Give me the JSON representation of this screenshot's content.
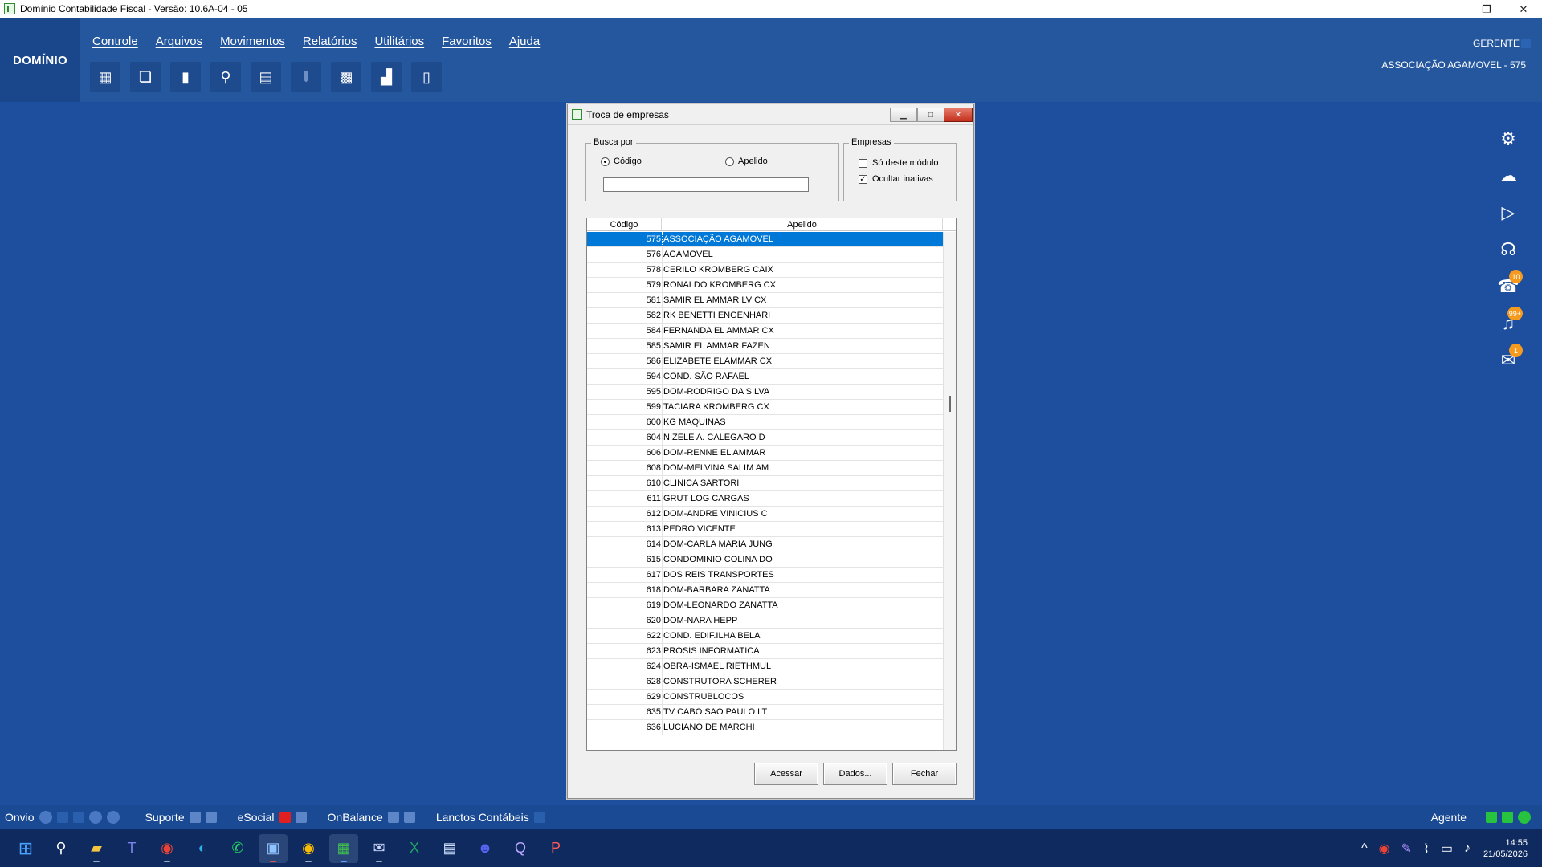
{
  "window": {
    "title": "Domínio Contabilidade Fiscal  - Versão: 10.6A-04 - 05"
  },
  "header": {
    "brand": "DOMÍNIO",
    "menu": [
      "Controle",
      "Arquivos",
      "Movimentos",
      "Relatórios",
      "Utilitários",
      "Favoritos",
      "Ajuda"
    ],
    "user": "GERENTE",
    "company": "ASSOCIAÇÃO AGAMOVEL  - 575",
    "toolbar_icons": [
      "building-icon",
      "companies-icon",
      "document-icon",
      "search-icon",
      "book-search-icon",
      "download-icon",
      "calculator-icon",
      "chart-search-icon",
      "door-icon"
    ]
  },
  "side_icons": [
    {
      "name": "gear-icon",
      "glyph": "⚙",
      "badge": ""
    },
    {
      "name": "cloud-upload-icon",
      "glyph": "☁",
      "badge": ""
    },
    {
      "name": "play-icon",
      "glyph": "▶",
      "badge": ""
    },
    {
      "name": "headset-icon",
      "glyph": "☊",
      "badge": ""
    },
    {
      "name": "support-icon",
      "glyph": "☎",
      "badge": "10"
    },
    {
      "name": "bell-icon",
      "glyph": "🔔",
      "badge": "99+"
    },
    {
      "name": "chat-icon",
      "glyph": "💬",
      "badge": "1"
    }
  ],
  "dialog": {
    "title": "Troca de empresas",
    "busca": {
      "legend": "Busca por",
      "codigo_label": "Código",
      "apelido_label": "Apelido",
      "selected": "codigo",
      "value": ""
    },
    "empresas": {
      "legend": "Empresas",
      "so_deste_modulo_label": "Só deste módulo",
      "so_deste_modulo_checked": false,
      "ocultar_inativas_label": "Ocultar inativas",
      "ocultar_inativas_checked": true
    },
    "columns": {
      "codigo": "Código",
      "apelido": "Apelido"
    },
    "rows": [
      {
        "codigo": "575",
        "apelido": "ASSOCIAÇÃO AGAMOVEL",
        "selected": true
      },
      {
        "codigo": "576",
        "apelido": "AGAMOVEL"
      },
      {
        "codigo": "578",
        "apelido": "CERILO KROMBERG CAIX"
      },
      {
        "codigo": "579",
        "apelido": "RONALDO KROMBERG CX"
      },
      {
        "codigo": "581",
        "apelido": "SAMIR EL AMMAR LV CX"
      },
      {
        "codigo": "582",
        "apelido": "RK BENETTI ENGENHARI"
      },
      {
        "codigo": "584",
        "apelido": "FERNANDA EL AMMAR CX"
      },
      {
        "codigo": "585",
        "apelido": "SAMIR EL AMMAR FAZEN"
      },
      {
        "codigo": "586",
        "apelido": "ELIZABETE ELAMMAR CX"
      },
      {
        "codigo": "594",
        "apelido": "COND. SÃO RAFAEL"
      },
      {
        "codigo": "595",
        "apelido": "DOM-RODRIGO DA SILVA"
      },
      {
        "codigo": "599",
        "apelido": "TACIARA KROMBERG CX"
      },
      {
        "codigo": "600",
        "apelido": "KG MAQUINAS"
      },
      {
        "codigo": "604",
        "apelido": "NIZELE A. CALEGARO D"
      },
      {
        "codigo": "606",
        "apelido": "DOM-RENNE  EL AMMAR"
      },
      {
        "codigo": "608",
        "apelido": "DOM-MELVINA SALIM AM"
      },
      {
        "codigo": "610",
        "apelido": "CLINICA SARTORI"
      },
      {
        "codigo": "611",
        "apelido": "GRUT LOG CARGAS"
      },
      {
        "codigo": "612",
        "apelido": "DOM-ANDRE VINICIUS C"
      },
      {
        "codigo": "613",
        "apelido": "PEDRO VICENTE"
      },
      {
        "codigo": "614",
        "apelido": "DOM-CARLA MARIA JUNG"
      },
      {
        "codigo": "615",
        "apelido": "CONDOMINIO COLINA DO"
      },
      {
        "codigo": "617",
        "apelido": "DOS REIS TRANSPORTES"
      },
      {
        "codigo": "618",
        "apelido": "DOM-BARBARA ZANATTA"
      },
      {
        "codigo": "619",
        "apelido": "DOM-LEONARDO ZANATTA"
      },
      {
        "codigo": "620",
        "apelido": "DOM-NARA HEPP"
      },
      {
        "codigo": "622",
        "apelido": "COND. EDIF.ILHA BELA"
      },
      {
        "codigo": "623",
        "apelido": "PROSIS INFORMATICA"
      },
      {
        "codigo": "624",
        "apelido": "OBRA-ISMAEL RIETHMUL"
      },
      {
        "codigo": "628",
        "apelido": "CONSTRUTORA SCHERER"
      },
      {
        "codigo": "629",
        "apelido": "CONSTRUBLOCOS"
      },
      {
        "codigo": "635",
        "apelido": "TV CABO SAO PAULO LT"
      },
      {
        "codigo": "636",
        "apelido": "LUCIANO DE MARCHI"
      }
    ],
    "buttons": {
      "acessar": "Acessar",
      "dados": "Dados...",
      "fechar": "Fechar"
    }
  },
  "statusbar": {
    "onvio": "Onvio",
    "suporte": "Suporte",
    "esocial": "eSocial",
    "onbalance": "OnBalance",
    "lanctos": "Lanctos Contábeis",
    "agente": "Agente"
  },
  "taskbar": {
    "apps": [
      "windows-start-icon",
      "search-icon",
      "file-explorer-icon",
      "teams-icon",
      "chrome-icon",
      "edge-icon",
      "whatsapp-icon",
      "remote-desktop-icon",
      "chrome-profile-icon",
      "dominio-app-icon",
      "outlook-icon",
      "excel-icon",
      "network-icon",
      "discord-icon",
      "app-q-icon",
      "app-p-icon"
    ],
    "time": "14:55",
    "date": "21/05/2026"
  },
  "colors": {
    "desktop": "#1e4f9e",
    "header": "#25579f",
    "selection": "#0078d7",
    "badge": "#f39a1f"
  }
}
